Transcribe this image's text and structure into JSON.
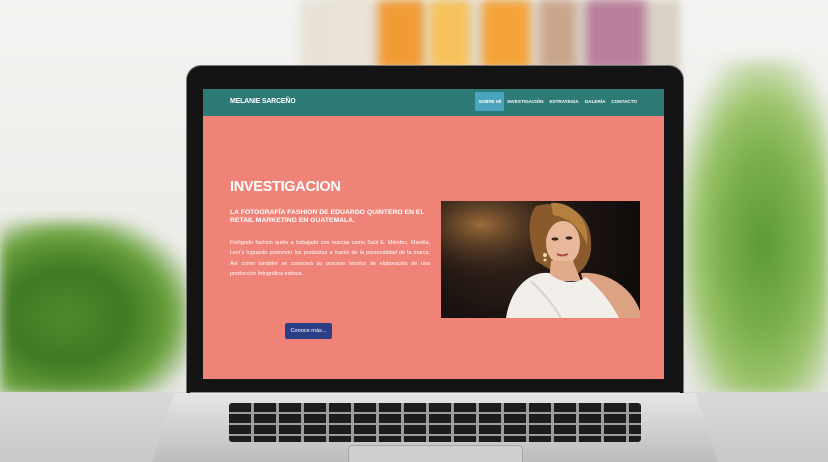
{
  "site": {
    "brand": "MELANIE SARCEÑO",
    "nav": [
      {
        "label": "SOBRE MÍ",
        "active": true
      },
      {
        "label": "INVESTIGACIÓN",
        "active": false
      },
      {
        "label": "ESTRATEGIA",
        "active": false
      },
      {
        "label": "GALERÍA",
        "active": false
      },
      {
        "label": "CONTACTO",
        "active": false
      }
    ]
  },
  "hero": {
    "title": "INVESTIGACION",
    "subtitle": "LA FOTOGRAFÍA FASHION DE EDUARDO QUINTERO EN EL RETAIL MARKETING EN GUATEMALA.",
    "body": "Fotógrafo fashion quién a trabajado con marcas como Saúl E. Méndez, Marella, Levi´s logrando promover los productos a través de la personalidad de la marca. Así como también se conocerá su proceso técnico de elaboración de una producción fotográfica exitosa.",
    "cta_label": "Conoce más..."
  },
  "colors": {
    "navbar": "#2e7a76",
    "active_nav": "#4aa3bf",
    "hero_bg": "#f08378",
    "cta": "#2b3f86"
  }
}
